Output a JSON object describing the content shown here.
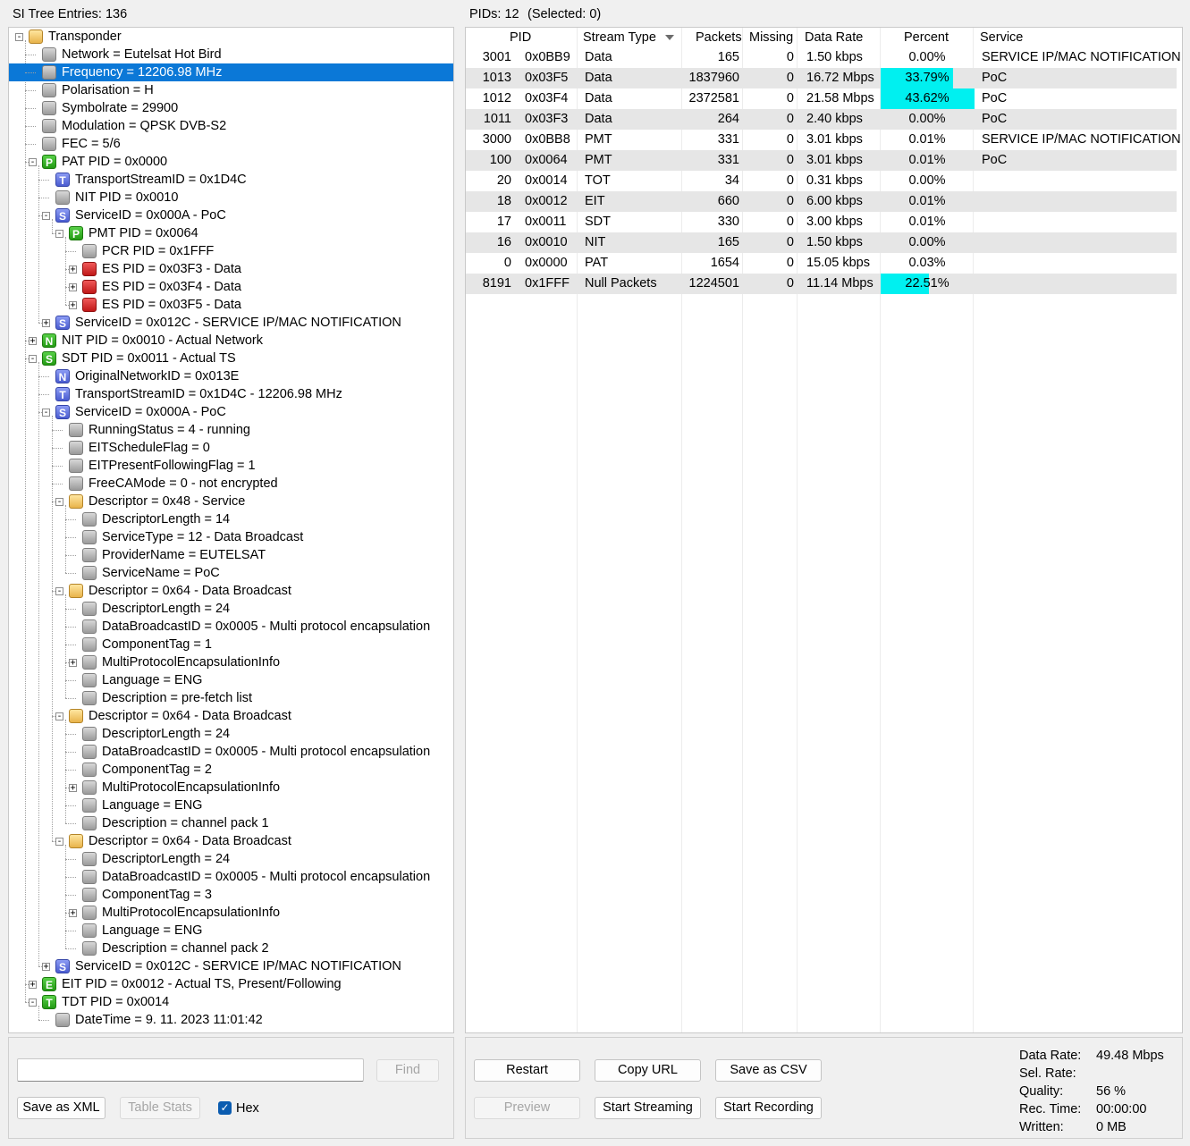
{
  "tree_header": "SI Tree Entries: 136",
  "pids_header": "PIDs: 12",
  "selected_header": "(Selected: 0)",
  "tree": [
    {
      "label": "Transponder",
      "level": 0,
      "icon": "folder",
      "exp": "-",
      "letter": ""
    },
    {
      "label": "Network = Eutelsat Hot Bird",
      "level": 1,
      "icon": "gray",
      "exp": "",
      "letter": ""
    },
    {
      "label": "Frequency = 12206.98 MHz",
      "level": 1,
      "icon": "gray",
      "exp": "",
      "letter": "",
      "selected": true
    },
    {
      "label": "Polarisation = H",
      "level": 1,
      "icon": "gray",
      "exp": "",
      "letter": ""
    },
    {
      "label": "Symbolrate = 29900",
      "level": 1,
      "icon": "gray",
      "exp": "",
      "letter": ""
    },
    {
      "label": "Modulation = QPSK DVB-S2",
      "level": 1,
      "icon": "gray",
      "exp": "",
      "letter": ""
    },
    {
      "label": "FEC = 5/6",
      "level": 1,
      "icon": "gray",
      "exp": "",
      "letter": ""
    },
    {
      "label": "PAT PID = 0x0000",
      "level": 1,
      "icon": "green",
      "exp": "-",
      "letter": "P"
    },
    {
      "label": "TransportStreamID = 0x1D4C",
      "level": 2,
      "icon": "blue",
      "exp": "",
      "letter": "T"
    },
    {
      "label": "NIT PID = 0x0010",
      "level": 2,
      "icon": "gray",
      "exp": "",
      "letter": ""
    },
    {
      "label": "ServiceID = 0x000A - PoC",
      "level": 2,
      "icon": "blue",
      "exp": "-",
      "letter": "S"
    },
    {
      "label": "PMT PID = 0x0064",
      "level": 3,
      "icon": "green",
      "exp": "-",
      "letter": "P"
    },
    {
      "label": "PCR PID = 0x1FFF",
      "level": 4,
      "icon": "gray",
      "exp": "",
      "letter": ""
    },
    {
      "label": "ES PID = 0x03F3 - Data",
      "level": 4,
      "icon": "red",
      "exp": "+",
      "letter": ""
    },
    {
      "label": "ES PID = 0x03F4 - Data",
      "level": 4,
      "icon": "red",
      "exp": "+",
      "letter": ""
    },
    {
      "label": "ES PID = 0x03F5 - Data",
      "level": 4,
      "icon": "red",
      "exp": "+",
      "letter": ""
    },
    {
      "label": "ServiceID = 0x012C - SERVICE IP/MAC NOTIFICATION",
      "level": 2,
      "icon": "blue",
      "exp": "+",
      "letter": "S"
    },
    {
      "label": "NIT PID = 0x0010 - Actual Network",
      "level": 1,
      "icon": "green",
      "exp": "+",
      "letter": "N"
    },
    {
      "label": "SDT PID = 0x0011 - Actual TS",
      "level": 1,
      "icon": "green",
      "exp": "-",
      "letter": "S"
    },
    {
      "label": "OriginalNetworkID = 0x013E",
      "level": 2,
      "icon": "blue",
      "exp": "",
      "letter": "N"
    },
    {
      "label": "TransportStreamID = 0x1D4C - 12206.98 MHz",
      "level": 2,
      "icon": "blue",
      "exp": "",
      "letter": "T"
    },
    {
      "label": "ServiceID = 0x000A - PoC",
      "level": 2,
      "icon": "blue",
      "exp": "-",
      "letter": "S"
    },
    {
      "label": "RunningStatus = 4 - running",
      "level": 3,
      "icon": "gray",
      "exp": "",
      "letter": ""
    },
    {
      "label": "EITScheduleFlag = 0",
      "level": 3,
      "icon": "gray",
      "exp": "",
      "letter": ""
    },
    {
      "label": "EITPresentFollowingFlag = 1",
      "level": 3,
      "icon": "gray",
      "exp": "",
      "letter": ""
    },
    {
      "label": "FreeCAMode = 0 - not encrypted",
      "level": 3,
      "icon": "gray",
      "exp": "",
      "letter": ""
    },
    {
      "label": "Descriptor = 0x48 - Service",
      "level": 3,
      "icon": "folder",
      "exp": "-",
      "letter": ""
    },
    {
      "label": "DescriptorLength = 14",
      "level": 4,
      "icon": "gray",
      "exp": "",
      "letter": ""
    },
    {
      "label": "ServiceType = 12 - Data Broadcast",
      "level": 4,
      "icon": "gray",
      "exp": "",
      "letter": ""
    },
    {
      "label": "ProviderName = EUTELSAT",
      "level": 4,
      "icon": "gray",
      "exp": "",
      "letter": ""
    },
    {
      "label": "ServiceName = PoC",
      "level": 4,
      "icon": "gray",
      "exp": "",
      "letter": ""
    },
    {
      "label": "Descriptor = 0x64 - Data Broadcast",
      "level": 3,
      "icon": "folder",
      "exp": "-",
      "letter": ""
    },
    {
      "label": "DescriptorLength = 24",
      "level": 4,
      "icon": "gray",
      "exp": "",
      "letter": ""
    },
    {
      "label": "DataBroadcastID = 0x0005 - Multi protocol encapsulation",
      "level": 4,
      "icon": "gray",
      "exp": "",
      "letter": ""
    },
    {
      "label": "ComponentTag = 1",
      "level": 4,
      "icon": "gray",
      "exp": "",
      "letter": ""
    },
    {
      "label": "MultiProtocolEncapsulationInfo",
      "level": 4,
      "icon": "gray",
      "exp": "+",
      "letter": ""
    },
    {
      "label": "Language = ENG",
      "level": 4,
      "icon": "gray",
      "exp": "",
      "letter": ""
    },
    {
      "label": "Description = pre-fetch list",
      "level": 4,
      "icon": "gray",
      "exp": "",
      "letter": ""
    },
    {
      "label": "Descriptor = 0x64 - Data Broadcast",
      "level": 3,
      "icon": "folder",
      "exp": "-",
      "letter": ""
    },
    {
      "label": "DescriptorLength = 24",
      "level": 4,
      "icon": "gray",
      "exp": "",
      "letter": ""
    },
    {
      "label": "DataBroadcastID = 0x0005 - Multi protocol encapsulation",
      "level": 4,
      "icon": "gray",
      "exp": "",
      "letter": ""
    },
    {
      "label": "ComponentTag = 2",
      "level": 4,
      "icon": "gray",
      "exp": "",
      "letter": ""
    },
    {
      "label": "MultiProtocolEncapsulationInfo",
      "level": 4,
      "icon": "gray",
      "exp": "+",
      "letter": ""
    },
    {
      "label": "Language = ENG",
      "level": 4,
      "icon": "gray",
      "exp": "",
      "letter": ""
    },
    {
      "label": "Description = channel pack 1",
      "level": 4,
      "icon": "gray",
      "exp": "",
      "letter": ""
    },
    {
      "label": "Descriptor = 0x64 - Data Broadcast",
      "level": 3,
      "icon": "folder",
      "exp": "-",
      "letter": ""
    },
    {
      "label": "DescriptorLength = 24",
      "level": 4,
      "icon": "gray",
      "exp": "",
      "letter": ""
    },
    {
      "label": "DataBroadcastID = 0x0005 - Multi protocol encapsulation",
      "level": 4,
      "icon": "gray",
      "exp": "",
      "letter": ""
    },
    {
      "label": "ComponentTag = 3",
      "level": 4,
      "icon": "gray",
      "exp": "",
      "letter": ""
    },
    {
      "label": "MultiProtocolEncapsulationInfo",
      "level": 4,
      "icon": "gray",
      "exp": "+",
      "letter": ""
    },
    {
      "label": "Language = ENG",
      "level": 4,
      "icon": "gray",
      "exp": "",
      "letter": ""
    },
    {
      "label": "Description = channel pack 2",
      "level": 4,
      "icon": "gray",
      "exp": "",
      "letter": ""
    },
    {
      "label": "ServiceID = 0x012C - SERVICE IP/MAC NOTIFICATION",
      "level": 2,
      "icon": "blue",
      "exp": "+",
      "letter": "S"
    },
    {
      "label": "EIT PID = 0x0012 - Actual TS, Present/Following",
      "level": 1,
      "icon": "green",
      "exp": "+",
      "letter": "E"
    },
    {
      "label": "TDT PID = 0x0014",
      "level": 1,
      "icon": "green",
      "exp": "-",
      "letter": "T"
    },
    {
      "label": "DateTime = 9. 11. 2023 11:01:42",
      "level": 2,
      "icon": "gray",
      "exp": "",
      "letter": ""
    }
  ],
  "table": {
    "columns": [
      "PID",
      "Stream Type",
      "Packets",
      "Missing",
      "Data Rate",
      "Percent",
      "Service"
    ],
    "sort_icon": "sort-down-icon",
    "rows": [
      {
        "pid": "3001",
        "hex": "0x0BB9",
        "type": "Data",
        "packets": "165",
        "missing": "0",
        "rate": "1.50 kbps",
        "percent": "0.00%",
        "pct_value": 0.0,
        "service": "SERVICE IP/MAC NOTIFICATION"
      },
      {
        "pid": "1013",
        "hex": "0x03F5",
        "type": "Data",
        "packets": "1837960",
        "missing": "0",
        "rate": "16.72 Mbps",
        "percent": "33.79%",
        "pct_value": 33.79,
        "service": "PoC"
      },
      {
        "pid": "1012",
        "hex": "0x03F4",
        "type": "Data",
        "packets": "2372581",
        "missing": "0",
        "rate": "21.58 Mbps",
        "percent": "43.62%",
        "pct_value": 43.62,
        "service": "PoC"
      },
      {
        "pid": "1011",
        "hex": "0x03F3",
        "type": "Data",
        "packets": "264",
        "missing": "0",
        "rate": "2.40 kbps",
        "percent": "0.00%",
        "pct_value": 0.0,
        "service": "PoC"
      },
      {
        "pid": "3000",
        "hex": "0x0BB8",
        "type": "PMT",
        "packets": "331",
        "missing": "0",
        "rate": "3.01 kbps",
        "percent": "0.01%",
        "pct_value": 0.01,
        "service": "SERVICE IP/MAC NOTIFICATION"
      },
      {
        "pid": "100",
        "hex": "0x0064",
        "type": "PMT",
        "packets": "331",
        "missing": "0",
        "rate": "3.01 kbps",
        "percent": "0.01%",
        "pct_value": 0.01,
        "service": "PoC"
      },
      {
        "pid": "20",
        "hex": "0x0014",
        "type": "TOT",
        "packets": "34",
        "missing": "0",
        "rate": "0.31 kbps",
        "percent": "0.00%",
        "pct_value": 0.0,
        "service": ""
      },
      {
        "pid": "18",
        "hex": "0x0012",
        "type": "EIT",
        "packets": "660",
        "missing": "0",
        "rate": "6.00 kbps",
        "percent": "0.01%",
        "pct_value": 0.01,
        "service": ""
      },
      {
        "pid": "17",
        "hex": "0x0011",
        "type": "SDT",
        "packets": "330",
        "missing": "0",
        "rate": "3.00 kbps",
        "percent": "0.01%",
        "pct_value": 0.01,
        "service": ""
      },
      {
        "pid": "16",
        "hex": "0x0010",
        "type": "NIT",
        "packets": "165",
        "missing": "0",
        "rate": "1.50 kbps",
        "percent": "0.00%",
        "pct_value": 0.0,
        "service": ""
      },
      {
        "pid": "0",
        "hex": "0x0000",
        "type": "PAT",
        "packets": "1654",
        "missing": "0",
        "rate": "15.05 kbps",
        "percent": "0.03%",
        "pct_value": 0.03,
        "service": ""
      },
      {
        "pid": "8191",
        "hex": "0x1FFF",
        "type": "Null Packets",
        "packets": "1224501",
        "missing": "0",
        "rate": "11.14 Mbps",
        "percent": "22.51%",
        "pct_value": 22.51,
        "service": ""
      }
    ]
  },
  "find": {
    "placeholder": "",
    "value": "",
    "button": "Find"
  },
  "left_buttons": {
    "save_xml": "Save as XML",
    "table_stats": "Table Stats",
    "hex_label": "Hex",
    "hex_checked": true
  },
  "right_buttons": {
    "restart": "Restart",
    "copy_url": "Copy URL",
    "save_csv": "Save as CSV",
    "preview": "Preview",
    "start_streaming": "Start Streaming",
    "start_recording": "Start Recording"
  },
  "stats": {
    "data_rate_label": "Data Rate:",
    "data_rate": "49.48 Mbps",
    "sel_rate_label": "Sel. Rate:",
    "sel_rate": "",
    "quality_label": "Quality:",
    "quality": "56 %",
    "rec_time_label": "Rec. Time:",
    "rec_time": "00:00:00",
    "written_label": "Written:",
    "written": "0 MB"
  },
  "colors": {
    "selection": "#0b78d7",
    "percent_bar": "#00f0f0",
    "alt_row": "#e6e6e6"
  }
}
